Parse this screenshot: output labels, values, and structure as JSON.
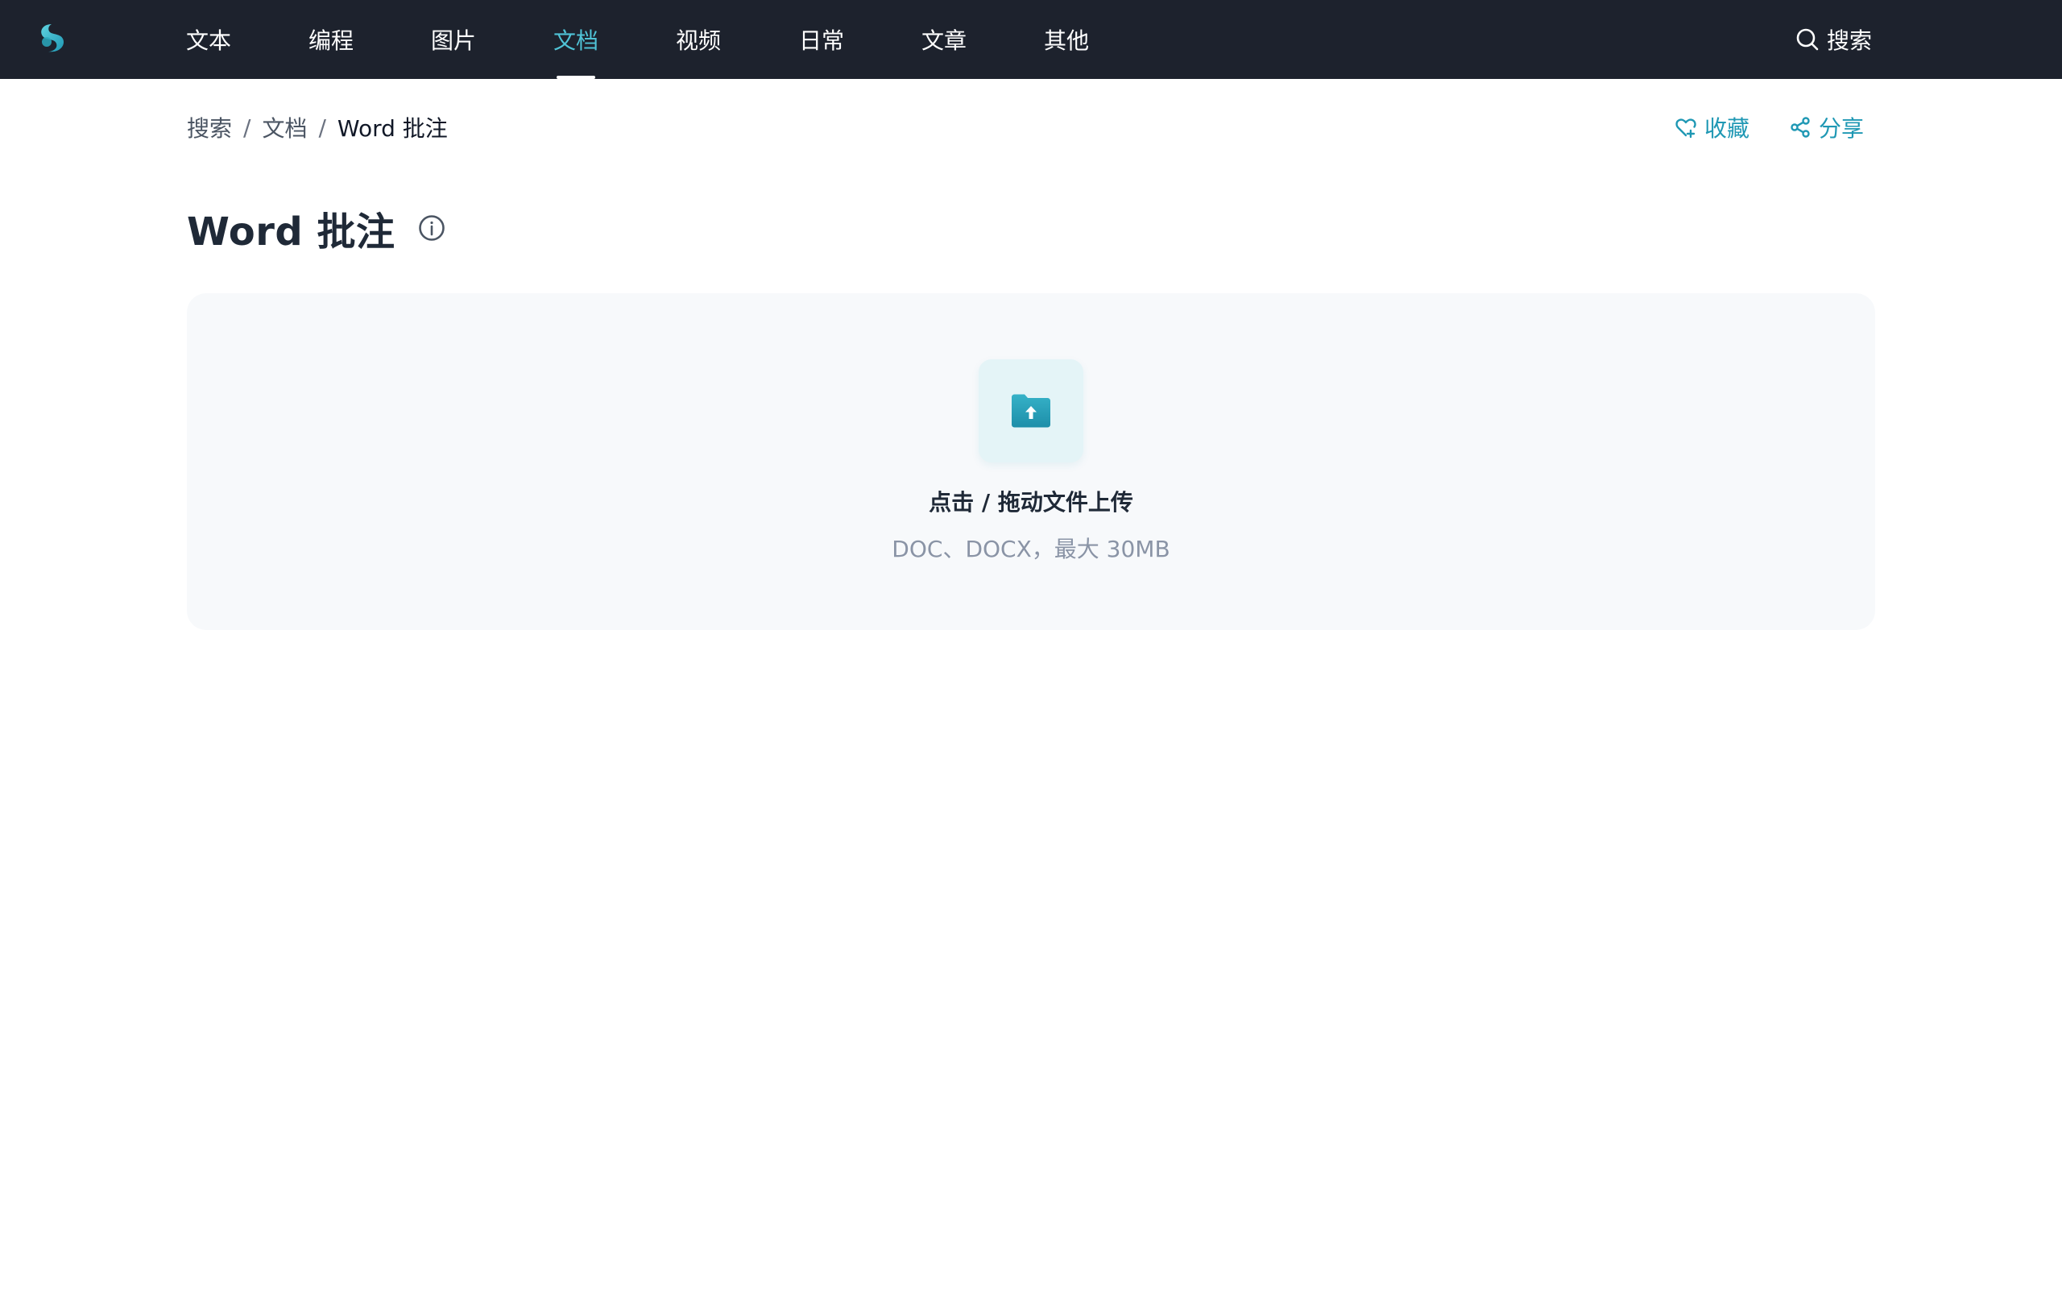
{
  "nav": {
    "items": [
      {
        "label": "文本"
      },
      {
        "label": "编程"
      },
      {
        "label": "图片"
      },
      {
        "label": "文档",
        "active": true
      },
      {
        "label": "视频"
      },
      {
        "label": "日常"
      },
      {
        "label": "文章"
      },
      {
        "label": "其他"
      }
    ],
    "search_label": "搜索",
    "logo_icon": "swirl-logo-icon"
  },
  "breadcrumb": {
    "items": [
      "搜索",
      "文档"
    ],
    "current": "Word 批注",
    "separator": "/"
  },
  "actions": {
    "favorite_label": "收藏",
    "favorite_icon": "heart-plus-icon",
    "share_label": "分享",
    "share_icon": "share-icon"
  },
  "page": {
    "title": "Word 批注",
    "info_icon": "info-icon"
  },
  "upload": {
    "title": "点击 / 拖动文件上传",
    "hint": "DOC、DOCX，最大 30MB",
    "icon": "folder-upload-icon"
  },
  "colors": {
    "topbar_bg": "#1d222d",
    "accent": "#1f98b4",
    "active_nav": "#4fc3d6",
    "dropzone_bg": "#f7f9fb"
  }
}
